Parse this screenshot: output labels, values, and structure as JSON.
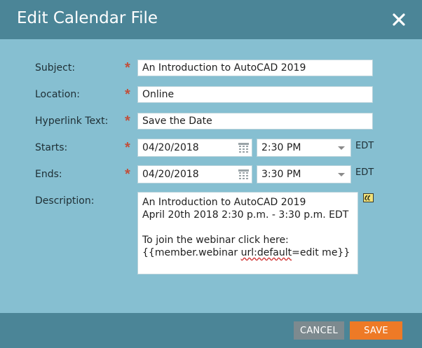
{
  "dialog": {
    "title": "Edit Calendar File",
    "close_icon": "close-icon"
  },
  "form": {
    "subject": {
      "label": "Subject:",
      "value": "An Introduction to AutoCAD 2019",
      "required": true
    },
    "location": {
      "label": "Location:",
      "value": "Online",
      "required": true
    },
    "hyperlink_text": {
      "label": "Hyperlink Text:",
      "value": "Save the Date",
      "required": true
    },
    "starts": {
      "label": "Starts:",
      "date": "04/20/2018",
      "time": "2:30 PM",
      "timezone": "EDT",
      "required": true
    },
    "ends": {
      "label": "Ends:",
      "date": "04/20/2018",
      "time": "3:30 PM",
      "timezone": "EDT",
      "required": true
    },
    "description": {
      "label": "Description:",
      "line1": "An Introduction to AutoCAD 2019",
      "line2": "April 20th 2018 2:30 p.m. - 3:30 p.m. EDT",
      "line4": "To join the webinar click here:",
      "line5_before": "{{member.webinar ",
      "line5_misspelled": "url:default",
      "line5_after": "=edit me}}"
    },
    "required_marker": "*"
  },
  "footer": {
    "cancel_label": "CANCEL",
    "save_label": "SAVE"
  },
  "colors": {
    "header": "#4b8597",
    "body": "#86bfd1",
    "save": "#ee7a26",
    "cancel": "#7d8a8f",
    "required": "#c0503c"
  }
}
